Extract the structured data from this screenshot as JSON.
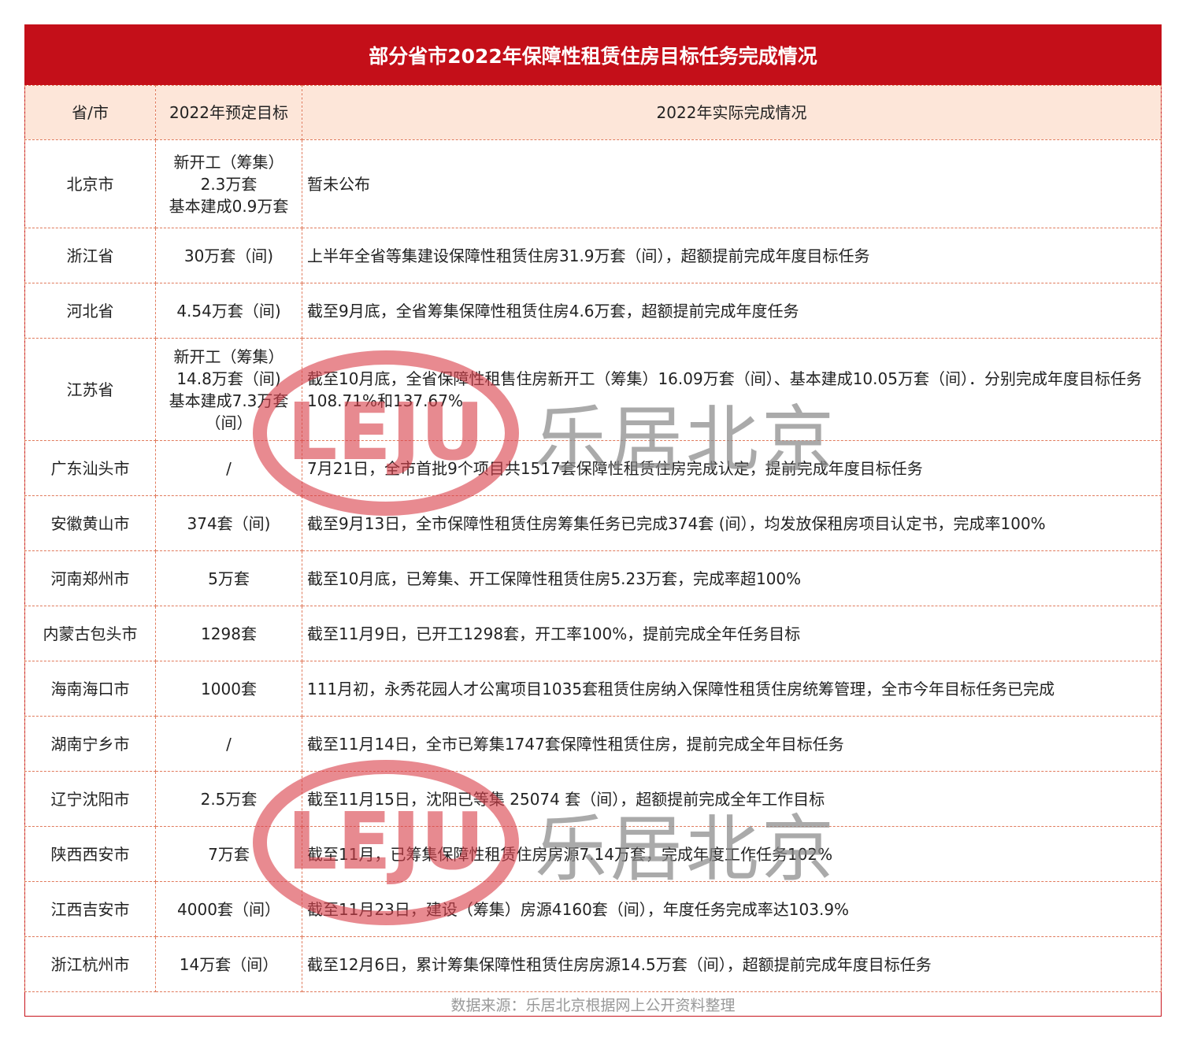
{
  "title": "部分省市2022年保障性租赁住房目标任务完成情况",
  "headers": [
    "省/市",
    "2022年预定目标",
    "2022年实际完成情况"
  ],
  "rows": [
    {
      "region": "北京市",
      "target": [
        "新开工（筹集）",
        "2.3万套",
        "基本建成0.9万套"
      ],
      "result": "暂未公布"
    },
    {
      "region": "浙江省",
      "target": [
        "30万套（间)"
      ],
      "result": "上半年全省等集建设保障性租赁住房31.9万套（间），超额提前完成年度目标任务"
    },
    {
      "region": "河北省",
      "target": [
        "4.54万套（间)"
      ],
      "result": "截至9月底，全省筹集保障性租赁住房4.6万套，超额提前完成年度任务"
    },
    {
      "region": "江苏省",
      "target": [
        "新开工（筹集）",
        "14.8万套（间)",
        "基本建成7.3万套",
        "（间）"
      ],
      "result": "截至10月底，全省保障性租售住房新开工（筹集）16.09万套（间）、基本建成10.05万套（间）．分别完成年度目标任务108.71%和137.67%"
    },
    {
      "region": "广东汕头市",
      "target": [
        "/"
      ],
      "result": "7月21日，全市首批9个项目共1517套保障性租赁住房完成认定，提前完成年度目标任务"
    },
    {
      "region": "安徽黄山市",
      "target": [
        "374套（间)"
      ],
      "result": "截至9月13日，全市保障性租赁住房筹集任务已完成374套 (间），均发放保租房项目认定书，完成率100%"
    },
    {
      "region": "河南郑州市",
      "target": [
        "5万套"
      ],
      "result": "截至10月底，已筹集、开工保障性租赁住房5.23万套，完成率超100%"
    },
    {
      "region": "内蒙古包头市",
      "target": [
        "1298套"
      ],
      "result": "截至11月9日，已开工1298套，开工率100%，提前完成全年任务目标"
    },
    {
      "region": "海南海口市",
      "target": [
        "1000套"
      ],
      "result": "111月初，永秀花园人才公寓项目1035套租赁住房纳入保障性租赁住房统筹管理，全市今年目标任务已完成"
    },
    {
      "region": "湖南宁乡市",
      "target": [
        "/"
      ],
      "result": "截至11月14日，全市已筹集1747套保障性租赁住房，提前完成全年目标任务"
    },
    {
      "region": "辽宁沈阳市",
      "target": [
        "2.5万套"
      ],
      "result": "截至11月15日，沈阳已等集 25074 套（间），超额提前完成全年工作目标"
    },
    {
      "region": "陕西西安市",
      "target": [
        "7万套"
      ],
      "result": "截至11月，已筹集保障性租赁住房房源7.14万套，完成年度工作任务102%"
    },
    {
      "region": "江西吉安市",
      "target": [
        "4000套（间）"
      ],
      "result": "截至11月23日，建设（筹集）房源4160套（间），年度任务完成率达103.9%"
    },
    {
      "region": "浙江杭州市",
      "target": [
        "14万套（间）"
      ],
      "result": "截至12月6日，累计筹集保障性租赁住房房源14.5万套（间），超额提前完成年度目标任务"
    }
  ],
  "footer": "数据来源：乐居北京根据网上公开资料整理",
  "watermark": {
    "logo": "LEJU",
    "text": "乐居北京"
  },
  "colors": {
    "title_bg": "#c40f19",
    "header_bg": "#fde6d9",
    "border": "#e07a5c",
    "watermark_red": "#d9414b"
  }
}
